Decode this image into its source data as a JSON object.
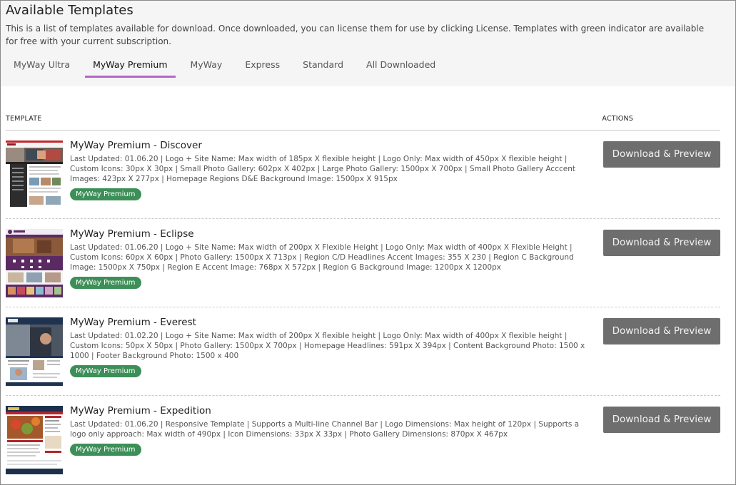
{
  "header": {
    "title": "Available Templates",
    "description": "This is a list of templates available for download. Once downloaded, you can license them for use by clicking License. Templates with green indicator are available for free with your current subscription."
  },
  "tabs": [
    {
      "label": "MyWay Ultra",
      "active": false
    },
    {
      "label": "MyWay Premium",
      "active": true
    },
    {
      "label": "MyWay",
      "active": false
    },
    {
      "label": "Express",
      "active": false
    },
    {
      "label": "Standard",
      "active": false
    },
    {
      "label": "All Downloaded",
      "active": false
    }
  ],
  "table": {
    "col_template": "TEMPLATE",
    "col_actions": "ACTIONS",
    "rows": [
      {
        "name": "MyWay Premium - Discover",
        "details": "Last Updated: 01.06.20 | Logo + Site Name: Max width of 185px X flexible height | Logo Only: Max width of 450px X flexible height | Custom Icons: 30px X 30px | Small Photo Gallery: 602px X 402px | Large Photo Gallery: 1500px X 700px | Small Photo Gallery Acccent Images: 423px X 277px | Homepage Regions D&E Background Image: 1500px X 915px",
        "badge": "MyWay Premium",
        "button": "Download & Preview"
      },
      {
        "name": "MyWay Premium - Eclipse",
        "details": "Last Updated: 01.06.20 | Logo + Site Name: Max width of 200px X Flexible Height | Logo Only: Max width of 400px X Flexible Height | Custom Icons: 60px X 60px | Photo Gallery: 1500px X 713px | Region C/D Headlines Accent Images: 355 X 230 | Region C Background Image: 1500px X 750px | Region E Accent Image: 768px X 572px | Region G Background Image: 1200px X 1200px",
        "badge": "MyWay Premium",
        "button": "Download & Preview"
      },
      {
        "name": "MyWay Premium - Everest",
        "details": "Last Updated: 01.02.20 | Logo + Site Name: Max width of 200px X flexible height | Logo Only: Max width of 400px X flexible height | Custom Icons: 50px X 50px | Photo Gallery: 1500px X 700px | Homepage Headlines: 591px X 394px | Content Background Photo: 1500 x 1000 | Footer Background Photo: 1500 x 400",
        "badge": "MyWay Premium",
        "button": "Download & Preview"
      },
      {
        "name": "MyWay Premium - Expedition",
        "details": "Last Updated: 01.06.20 | Responsive Template | Supports a Multi-line Channel Bar | Logo Dimensions: Max height of 120px | Supports a logo only approach: Max width of 490px | Icon Dimensions: 33px X 33px | Photo Gallery Dimensions: 870px X 467px",
        "badge": "MyWay Premium",
        "button": "Download & Preview"
      }
    ]
  },
  "colors": {
    "tab_active_underline": "#b565c9",
    "badge_green": "#3d8f58",
    "button_gray": "#6e6e6e",
    "header_bg": "#f5f5f5"
  }
}
